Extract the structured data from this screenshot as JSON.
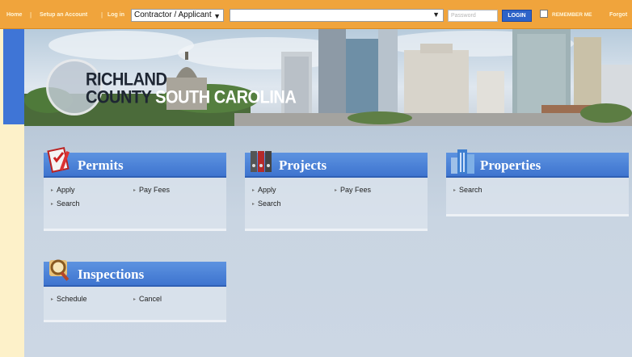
{
  "topbar": {
    "home": "Home",
    "setup_account": "Setup an Account",
    "login_link": "Log in",
    "role_select": "Contractor / Applicant",
    "main_select": "",
    "password_placeholder": "Password",
    "login_button": "LOGIN",
    "remember_me": "REMEMBER ME",
    "forgot": "Forgot"
  },
  "banner": {
    "county_line1": "RICHLAND",
    "county_line2a": "COUNTY",
    "county_line2b": "SOUTH CAROLINA"
  },
  "cards": {
    "permits": {
      "title": "Permits",
      "links": [
        "Apply",
        "Pay Fees",
        "Search"
      ]
    },
    "projects": {
      "title": "Projects",
      "links": [
        "Apply",
        "Pay Fees",
        "Search"
      ]
    },
    "properties": {
      "title": "Properties",
      "links": [
        "Search"
      ]
    },
    "inspections": {
      "title": "Inspections",
      "links": [
        "Schedule",
        "Cancel"
      ]
    }
  },
  "colors": {
    "topbar": "#f0a43c",
    "card_header": "#3e74cf",
    "left_strip": "#3f75d6"
  },
  "icons": [
    "permit-checklist-icon",
    "binders-icon",
    "buildings-icon",
    "magnifier-icon",
    "chevron-down-icon"
  ]
}
